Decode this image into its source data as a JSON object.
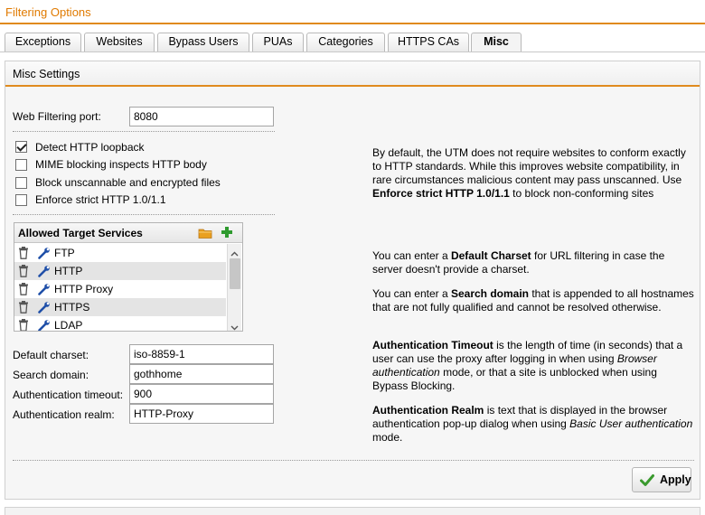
{
  "page": {
    "title": "Filtering Options"
  },
  "tabs": [
    "Exceptions",
    "Websites",
    "Bypass Users",
    "PUAs",
    "Categories",
    "HTTPS CAs",
    "Misc"
  ],
  "active_tab": "Misc",
  "panel": {
    "title": "Misc Settings"
  },
  "port": {
    "label": "Web Filtering port:",
    "value": "8080"
  },
  "options": [
    {
      "label": "Detect HTTP loopback",
      "checked": true
    },
    {
      "label": "MIME blocking inspects HTTP body",
      "checked": false
    },
    {
      "label": "Block unscannable and encrypted files",
      "checked": false
    },
    {
      "label": "Enforce strict HTTP 1.0/1.1",
      "checked": false
    }
  ],
  "services": {
    "title": "Allowed Target Services",
    "items": [
      "FTP",
      "HTTP",
      "HTTP Proxy",
      "HTTPS",
      "LDAP"
    ]
  },
  "fields": {
    "charset": {
      "label": "Default charset:",
      "value": "iso-8859-1"
    },
    "search_domain": {
      "label": "Search domain:",
      "value": "gothhome"
    },
    "auth_timeout": {
      "label": "Authentication timeout:",
      "value": "900"
    },
    "auth_realm": {
      "label": "Authentication realm:",
      "value": "HTTP-Proxy"
    }
  },
  "help": {
    "strict": {
      "pre": "By default, the UTM does not require websites to conform exactly to HTTP standards. While this improves website compatibility, in rare circumstances malicious content may pass unscanned. Use ",
      "bold": "Enforce strict HTTP 1.0/1.1",
      "post": " to block non-conforming sites"
    },
    "charset": {
      "pre": "You can enter a ",
      "bold": "Default Charset",
      "post": " for URL filtering in case the server doesn't provide a charset."
    },
    "search": {
      "pre": "You can enter a ",
      "bold": "Search domain",
      "post": " that is appended to all hostnames that are not fully qualified and cannot be resolved otherwise."
    },
    "timeout": {
      "bold": "Authentication Timeout",
      "mid": " is the length of time (in seconds) that a user can use the proxy after logging in when using ",
      "italic": "Browser authentication",
      "post": " mode, or that a site is unblocked when using Bypass Blocking."
    },
    "realm": {
      "bold": "Authentication Realm",
      "mid": " is text that is displayed in the browser authentication pop-up dialog when using ",
      "italic": "Basic User authentication",
      "post": " mode."
    }
  },
  "apply_label": "Apply",
  "colors": {
    "accent": "#e08a1e",
    "title": "#e07a00",
    "wrench": "#1f4fa8",
    "add": "#2f9a2f",
    "check": "#3a9a2e",
    "folder": "#e9a020"
  },
  "icons": {
    "trash": "trash-icon",
    "wrench": "wrench-icon",
    "folder": "folder-icon",
    "add": "plus-icon",
    "apply": "checkmark-icon"
  }
}
